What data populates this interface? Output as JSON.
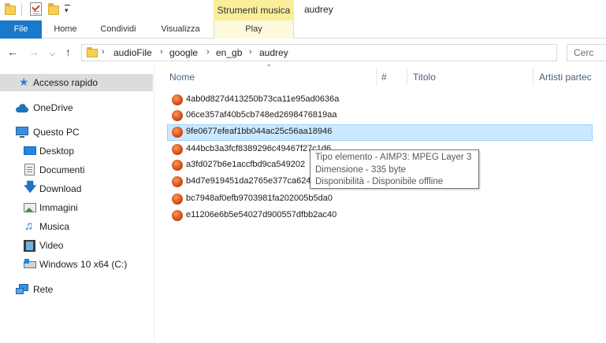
{
  "window": {
    "title": "audrey",
    "context_tab_group": "Strumenti musica"
  },
  "ribbon": {
    "tabs": [
      {
        "label": "File",
        "active": true
      },
      {
        "label": "Home"
      },
      {
        "label": "Condividi"
      },
      {
        "label": "Visualizza"
      },
      {
        "label": "Play",
        "contextual": true
      }
    ]
  },
  "address": {
    "breadcrumbs": [
      "audioFile",
      "google",
      "en_gb",
      "audrey"
    ]
  },
  "search": {
    "placeholder": "Cerc"
  },
  "sidebar": {
    "items": [
      {
        "label": "Accesso rapido",
        "icon": "star-pin-icon",
        "selected": true
      },
      {
        "label": "OneDrive",
        "icon": "cloud-icon"
      },
      {
        "label": "Questo PC",
        "icon": "computer-icon"
      },
      {
        "label": "Desktop",
        "icon": "desktop-icon"
      },
      {
        "label": "Documenti",
        "icon": "documents-icon"
      },
      {
        "label": "Download",
        "icon": "download-arrow-icon"
      },
      {
        "label": "Immagini",
        "icon": "pictures-icon"
      },
      {
        "label": "Musica",
        "icon": "music-note-icon"
      },
      {
        "label": "Video",
        "icon": "video-film-icon"
      },
      {
        "label": "Windows 10 x64 (C:)",
        "icon": "drive-icon"
      },
      {
        "label": "Rete",
        "icon": "network-icon"
      }
    ]
  },
  "columns": {
    "name": "Nome",
    "track": "#",
    "title": "Titolo",
    "artists": "Artisti partec"
  },
  "files": [
    {
      "name": "4ab0d827d413250b73ca11e95ad0636a"
    },
    {
      "name": "06ce357af40b5cb748ed2698476819aa"
    },
    {
      "name": "9fe0677efeaf1bb044ac25c56aa18946",
      "selected": true
    },
    {
      "name": "444bcb3a3fcf8389296c49467f27c1d6"
    },
    {
      "name": "a3fd027b6e1accfbd9ca549202"
    },
    {
      "name": "b4d7e919451da2765e377ca624"
    },
    {
      "name": "bc7948af0efb9703981fa202005b5da0"
    },
    {
      "name": "e11206e6b5e54027d900557dfbb2ac40"
    }
  ],
  "tooltip": {
    "type_line": "Tipo elemento - AIMP3: MPEG Layer 3",
    "size_line": "Dimensione - 335 byte",
    "availability_line": "Disponibilità - Disponibile offline"
  },
  "colors": {
    "file_tab": "#1979ca",
    "context_tab": "#fbee9a",
    "selection": "#cce8ff",
    "selection_border": "#99d1ff",
    "column_header_text": "#4c607a"
  }
}
